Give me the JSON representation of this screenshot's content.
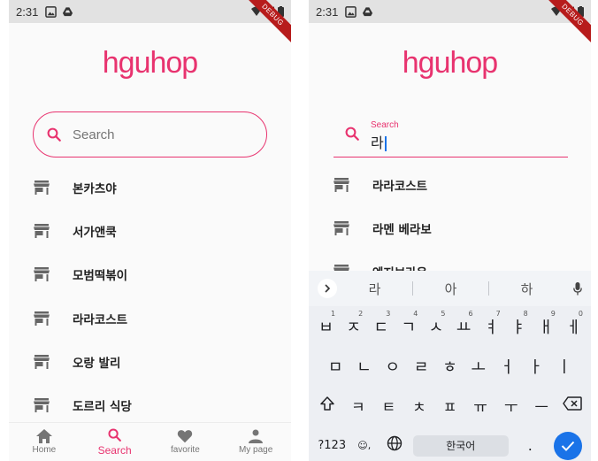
{
  "status_bar": {
    "time": "2:31"
  },
  "debug_banner": "DEBUG",
  "app": {
    "logo_text": "hguhop"
  },
  "left_screen": {
    "search": {
      "placeholder": "Search"
    },
    "stores": [
      "본카츠야",
      "서가앤쿡",
      "모범떡볶이",
      "라라코스트",
      "오랑 발리",
      "도르리 식당"
    ],
    "bottom_nav": [
      {
        "label": "Home",
        "icon": "home-icon"
      },
      {
        "label": "Search",
        "icon": "search-icon",
        "active": true
      },
      {
        "label": "favorite",
        "icon": "heart-icon"
      },
      {
        "label": "My page",
        "icon": "person-icon"
      }
    ]
  },
  "right_screen": {
    "search": {
      "label": "Search",
      "value": "라"
    },
    "stores": [
      "라라코스트",
      "라멘 베라보",
      "엔지브라운"
    ],
    "keyboard": {
      "suggestions": [
        "라",
        "아",
        "하"
      ],
      "row1": [
        "ㅂ",
        "ㅈ",
        "ㄷ",
        "ㄱ",
        "ㅅ",
        "ㅛ",
        "ㅕ",
        "ㅑ",
        "ㅐ",
        "ㅔ"
      ],
      "row1_numbers": [
        "1",
        "2",
        "3",
        "4",
        "5",
        "6",
        "7",
        "8",
        "9",
        "0"
      ],
      "row2": [
        "ㅁ",
        "ㄴ",
        "ㅇ",
        "ㄹ",
        "ㅎ",
        "ㅗ",
        "ㅓ",
        "ㅏ",
        "ㅣ"
      ],
      "row3": [
        "ㅋ",
        "ㅌ",
        "ㅊ",
        "ㅍ",
        "ㅠ",
        "ㅜ",
        "ㅡ"
      ],
      "symbols_key": "?123",
      "emoji_key": "☺,",
      "space_label": "한국어",
      "period_key": "."
    }
  },
  "colors": {
    "accent": "#e8336f",
    "keyboard_blue": "#1a73e8",
    "debug_red": "#b71c1c"
  }
}
